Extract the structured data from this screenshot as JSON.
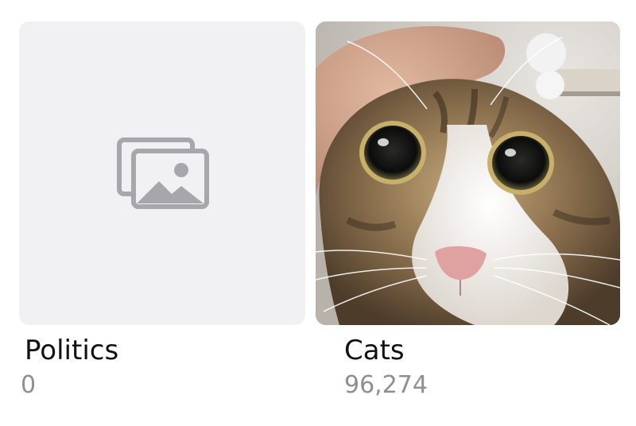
{
  "albums": [
    {
      "title": "Politics",
      "count": "0",
      "thumbnail": "placeholder-photos-icon"
    },
    {
      "title": "Cats",
      "count": "96,274",
      "thumbnail": "cat-closeup-photo"
    }
  ],
  "colors": {
    "placeholder_bg": "#f1f1f3",
    "placeholder_icon": "#a7a7ab",
    "title": "#111111",
    "count": "#8e8e93"
  }
}
